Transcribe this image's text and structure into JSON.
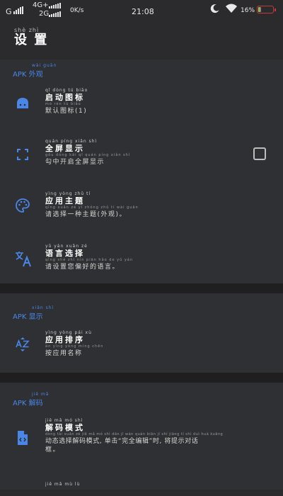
{
  "status_bar": {
    "carrier_1": "G",
    "carrier_2_top": "4G+",
    "carrier_2_bottom": "2G",
    "speed": "0K/s",
    "time": "21:08",
    "battery": "16%",
    "battery_level": 0.16,
    "icons": [
      "signal-icon",
      "moon-icon",
      "wifi-icon",
      "battery-icon"
    ]
  },
  "header": {
    "title_pinyin": "shè zhì",
    "title": "设 置"
  },
  "sections": [
    {
      "label": "APK 外观",
      "label_pinyin": "wài guān",
      "items": [
        {
          "icon": "android-icon",
          "title_pinyin": "qǐ dòng tú biāo",
          "title": "启动图标",
          "sub_pinyin": "mò rèn tú biāo",
          "subtitle": "默认图标(1)"
        },
        {
          "icon": "fullscreen-icon",
          "title_pinyin": "quán píng xiǎn shì",
          "title": "全屏显示",
          "sub_pinyin": "gōu dòng kāi qǐ quán píng xiǎn shì",
          "subtitle": "勾中开启全屏显示",
          "checked": false
        },
        {
          "icon": "palette-icon",
          "title_pinyin": "yìng yòng zhǔ tí",
          "title": "应用主题",
          "sub_pinyin": "qǐng xuǎn zé yī zhǒng zhǔ tí wài guān",
          "subtitle": "请选择一种主题(外观)。"
        },
        {
          "icon": "translate-icon",
          "title_pinyin": "yǔ yán xuǎn zé",
          "title": "语言选择",
          "sub_pinyin": "qǐng shè zhì nín piān hǎo de yǔ yán",
          "subtitle": "请设置您偏好的语言。"
        }
      ]
    },
    {
      "label": "APK 显示",
      "label_pinyin": "xiǎn shì",
      "items": [
        {
          "icon": "sort-az-icon",
          "title_pinyin": "yìng yòng pái xù",
          "title": "应用排序",
          "sub_pinyin": "àn yìng yòng míng chēn",
          "subtitle": "按应用名称"
        }
      ]
    },
    {
      "label": "APK 解码",
      "label_pinyin": "jiě mǎ",
      "items": [
        {
          "icon": "code-file-icon",
          "title_pinyin": "jiě mǎ mó shì",
          "title": "解码模式",
          "sub_pinyin": "dòng tài xuǎn zé jiě mǎ mó shì dān jī wán quán biān jí shí jiāng tí shì duì huà kuāng",
          "subtitle": "动态选择解码模式, 单击“完全编辑”时, 将提示对话",
          "subtitle2": "框。"
        },
        {
          "icon": "",
          "title_pinyin": "jiě mǎ mù lù",
          "title": "",
          "sub_pinyin": "",
          "subtitle": ""
        }
      ]
    }
  ]
}
